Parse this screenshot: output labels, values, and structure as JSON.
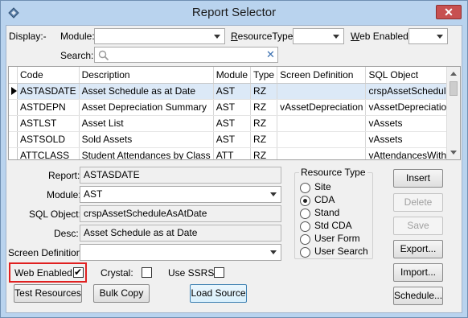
{
  "window": {
    "title": "Report Selector",
    "close_glyph": "✕"
  },
  "filter": {
    "display_label": "Display:-",
    "module_label": "Module:",
    "module_value": "",
    "resource_type_label": "ResourceType:",
    "resource_type_value": "",
    "web_enabled_label": "Web Enabled:",
    "web_enabled_value": "",
    "search_label": "Search:",
    "search_value": "",
    "clear_glyph": "✕"
  },
  "grid": {
    "columns": [
      "Code",
      "Description",
      "Module",
      "Type",
      "Screen Definition",
      "SQL Object"
    ],
    "rows": [
      [
        "ASTASDATE",
        "Asset Schedule as at Date",
        "AST",
        "RZ",
        "",
        "crspAssetScheduleAsAtDate"
      ],
      [
        "ASTDEPN",
        "Asset Depreciation Summary",
        "AST",
        "RZ",
        "vAssetDepreciation",
        "vAssetDepreciation"
      ],
      [
        "ASTLST",
        "Asset List",
        "AST",
        "RZ",
        "",
        "vAssets"
      ],
      [
        "ASTSOLD",
        "Sold Assets",
        "AST",
        "RZ",
        "",
        "vAssets"
      ],
      [
        "ATTCLASS",
        "Student Attendances by Class",
        "ATT",
        "RZ",
        "",
        "vAttendancesWithAbsences"
      ]
    ],
    "selected_row": 0
  },
  "details": {
    "report_label": "Report:",
    "report_value": "ASTASDATE",
    "module_label": "Module:",
    "module_value": "AST",
    "sql_label": "SQL Object:",
    "sql_value": "crspAssetScheduleAsAtDate",
    "desc_label": "Desc:",
    "desc_value": "Asset Schedule as at Date",
    "screen_def_label": "Screen Definition:",
    "screen_def_value": ""
  },
  "resource_type": {
    "title": "Resource Type",
    "options": [
      "Site",
      "CDA",
      "Stand",
      "Std CDA",
      "User Form",
      "User Search"
    ],
    "selected": "CDA"
  },
  "options": {
    "web_enabled_label": "Web Enabled:",
    "web_enabled_checked": true,
    "crystal_label": "Crystal:",
    "crystal_checked": false,
    "use_ssrs_label": "Use SSRS:",
    "use_ssrs_checked": false,
    "check_glyph": "✔"
  },
  "buttons": {
    "insert": "Insert",
    "delete": "Delete",
    "save": "Save",
    "export": "Export...",
    "import": "Import...",
    "schedule": "Schedule...",
    "test_resources": "Test Resources",
    "bulk_copy": "Bulk Copy",
    "load_source": "Load Source"
  }
}
